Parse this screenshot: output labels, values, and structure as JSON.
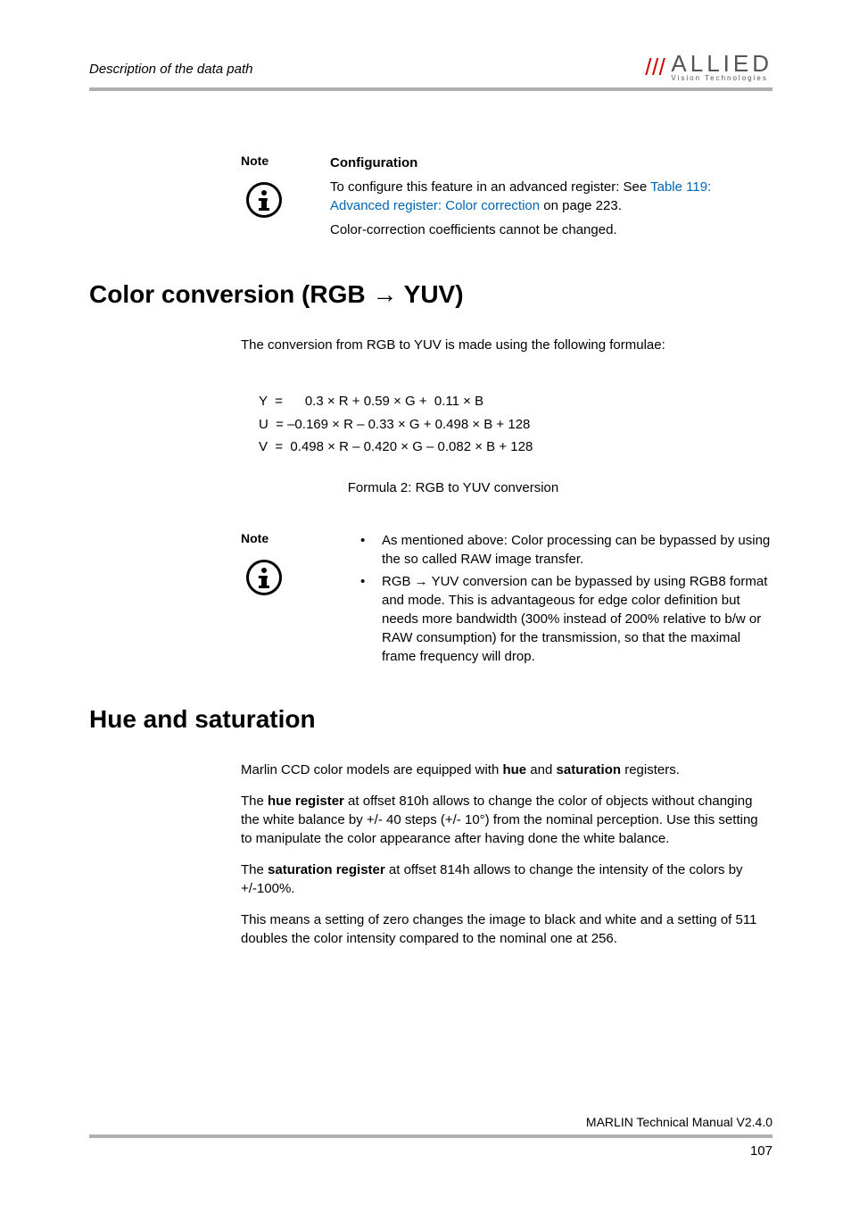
{
  "header": {
    "section": "Description of the data path",
    "logo_top": "ALLIED",
    "logo_bottom": "Vision Technologies"
  },
  "note1": {
    "label": "Note",
    "heading": "Configuration",
    "line1a": "To configure this feature in an advanced register: See ",
    "link": "Table 119: Advanced register: Color correction",
    "line1b": " on page 223.",
    "line2": "Color-correction coefficients cannot be changed."
  },
  "h1a": "Color conversion (RGB → YUV)",
  "intro": "The conversion from RGB to YUV is made using the following formulae:",
  "formulas": {
    "y": "Y  =      0.3 × R + 0.59 × G +  0.11 × B",
    "u": "U  = –0.169 × R – 0.33 × G + 0.498 × B + 128",
    "v": "V  =  0.498 × R – 0.420 × G – 0.082 × B + 128",
    "caption": "Formula 2: RGB to YUV conversion"
  },
  "note2": {
    "label": "Note",
    "b1": "As mentioned above: Color processing can be bypassed by using the so called RAW image transfer.",
    "b2": "RGB → YUV conversion can be bypassed by using RGB8 format and mode. This is advantageous for edge color definition but needs more bandwidth (300% instead of 200% relative to b/w or RAW consumption) for the transmission, so that the maximal frame frequency will drop."
  },
  "h1b": "Hue and saturation",
  "hue": {
    "p1a": "Marlin CCD color models are equipped with ",
    "p1b": "hue",
    "p1c": " and ",
    "p1d": "saturation",
    "p1e": " registers.",
    "p2a": "The ",
    "p2b": "hue register",
    "p2c": " at offset 810h allows to change the color of objects without changing the white balance by +/- 40 steps (+/- 10°) from the nominal perception. Use this setting to manipulate the color appearance after having done the white balance.",
    "p3a": "The ",
    "p3b": "saturation register",
    "p3c": " at offset 814h allows to change the intensity of the colors by +/-100%.",
    "p4": "This means a setting of zero changes the image to black and white and a setting of 511 doubles the color intensity compared to the nominal one at 256."
  },
  "footer": {
    "text": "MARLIN Technical Manual V2.4.0",
    "page": "107"
  }
}
